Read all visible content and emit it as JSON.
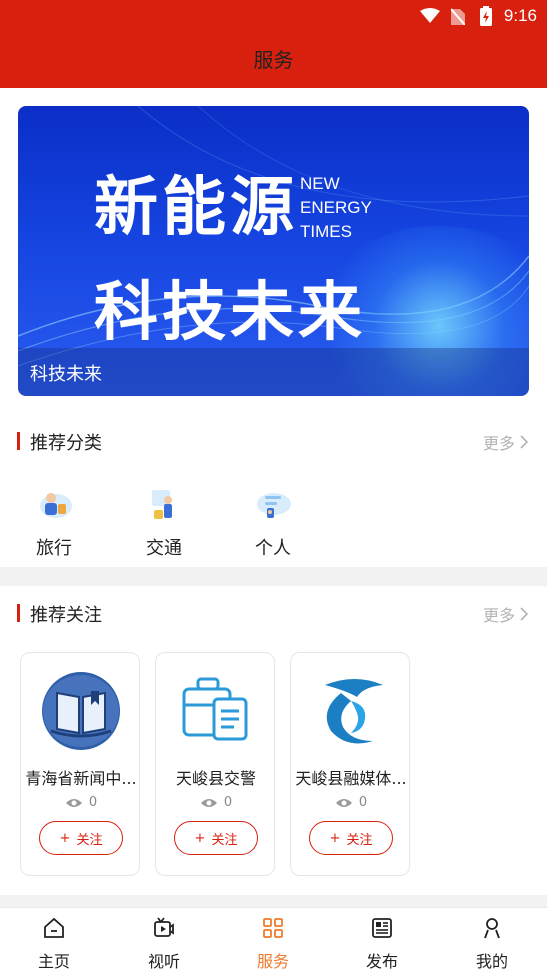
{
  "status_bar": {
    "time": "9:16",
    "icons": [
      "wifi-icon",
      "no-sim-icon",
      "battery-charging-icon"
    ]
  },
  "header": {
    "title": "服务"
  },
  "banner": {
    "headline_line1": "新能源",
    "headline_line2": "科技未来",
    "english_line1": "NEW",
    "english_line2": "ENERGY",
    "english_line3": "TIMES",
    "caption": "科技未来"
  },
  "recommended_categories": {
    "title": "推荐分类",
    "more_label": "更多",
    "items": [
      {
        "label": "旅行",
        "icon": "travel-icon"
      },
      {
        "label": "交通",
        "icon": "traffic-icon"
      },
      {
        "label": "个人",
        "icon": "personal-icon"
      }
    ]
  },
  "recommended_follows": {
    "title": "推荐关注",
    "more_label": "更多",
    "cards": [
      {
        "name": "青海省新闻中...",
        "views": "0",
        "follow_label": "关注",
        "icon": "book-logo-icon"
      },
      {
        "name": "天峻县交警",
        "views": "0",
        "follow_label": "关注",
        "icon": "briefcase-logo-icon"
      },
      {
        "name": "天峻县融媒体...",
        "views": "0",
        "follow_label": "关注",
        "icon": "wave-logo-icon"
      }
    ]
  },
  "tab_bar": {
    "items": [
      {
        "label": "主页",
        "icon": "home-icon",
        "active": false
      },
      {
        "label": "视听",
        "icon": "video-icon",
        "active": false
      },
      {
        "label": "服务",
        "icon": "grid-icon",
        "active": true
      },
      {
        "label": "发布",
        "icon": "newspaper-icon",
        "active": false
      },
      {
        "label": "我的",
        "icon": "user-icon",
        "active": false
      }
    ]
  },
  "colors": {
    "brand_red": "#d8200f",
    "active_tab": "#f07a2a",
    "banner_blue": "#1544e0"
  }
}
